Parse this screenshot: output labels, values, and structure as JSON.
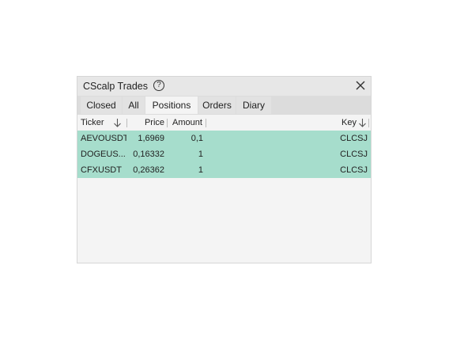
{
  "window": {
    "title": "CScalp Trades",
    "help_glyph": "?"
  },
  "tabs": [
    {
      "label": "Closed",
      "active": false
    },
    {
      "label": "All",
      "active": false
    },
    {
      "label": "Positions",
      "active": true
    },
    {
      "label": "Orders",
      "active": false
    },
    {
      "label": "Diary",
      "active": false
    }
  ],
  "table": {
    "columns": {
      "ticker": "Ticker",
      "price": "Price",
      "amount": "Amount",
      "key": "Key"
    },
    "rows": [
      {
        "ticker": "AEVOUSDT",
        "price": "1,6969",
        "amount": "0,1",
        "key": "CLCSJ"
      },
      {
        "ticker": "DOGEUS...",
        "price": "0,16332",
        "amount": "1",
        "key": "CLCSJ"
      },
      {
        "ticker": "CFXUSDT",
        "price": "0,26362",
        "amount": "1",
        "key": "CLCSJ"
      }
    ]
  },
  "colors": {
    "row_highlight": "#a6ddcc",
    "window_bg": "#f4f4f4",
    "tabbar_bg": "#dcdcdc"
  },
  "icons": [
    "help-icon",
    "close-icon",
    "sort-down-icon"
  ]
}
